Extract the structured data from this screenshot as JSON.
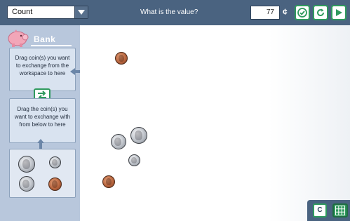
{
  "toolbar": {
    "mode_select": "Count",
    "question": "What is the value?",
    "value": "77",
    "unit": "¢"
  },
  "bank": {
    "title": "Bank",
    "drag_to_bank_text": "Drag coin(s) you want to exchange from the workspace to here",
    "drag_from_below_text": "Drag the coin(s) you want to exchange with from below to here"
  },
  "bottom_tools": {
    "cents_button": "C"
  },
  "icons": {
    "check": "check-circle-icon",
    "reset": "refresh-icon",
    "next": "play-icon",
    "exchange": "exchange-arrows-icon",
    "piggy": "piggy-bank-icon",
    "grid": "grid-icon"
  },
  "colors": {
    "topbar": "#4a6380",
    "sidebar": "#b8c7dc",
    "button_accent": "#2f9a5d"
  },
  "workspace_coins": [
    "penny",
    "quarter",
    "quarter",
    "dime",
    "penny"
  ],
  "bin_coins": [
    "quarter",
    "dime",
    "nickel",
    "penny"
  ]
}
